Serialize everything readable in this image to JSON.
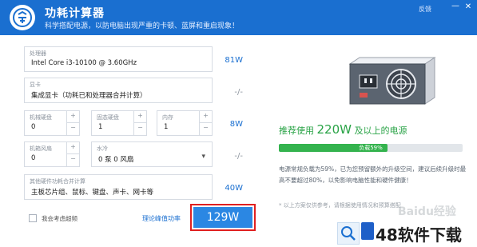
{
  "header": {
    "title": "功耗计算器",
    "subtitle": "科学搭配电源，以防电脑出现严重的卡顿、蓝屏和重启现象！",
    "feedback": "反馈",
    "minimize": "—",
    "close": "✕"
  },
  "form": {
    "cpu": {
      "label": "处理器",
      "value": "Intel Core i3-10100 @ 3.60GHz",
      "watt": "81W"
    },
    "gpu": {
      "label": "显卡",
      "value": "集成显卡（功耗已和处理器合并计算）",
      "watt": "-/-"
    },
    "hdd": {
      "label": "机械硬盘",
      "value": "0"
    },
    "ssd": {
      "label": "固态硬盘",
      "value": "1"
    },
    "ram": {
      "label": "内存",
      "value": "1",
      "watt": "8W"
    },
    "fan": {
      "label": "机箱风扇",
      "value": "0"
    },
    "water": {
      "label": "水冷",
      "value": "0 泵 0 风扇",
      "watt": "-/-"
    },
    "other": {
      "label": "其他硬件功耗合并计算",
      "value": "主板芯片组、鼠标、键盘、声卡、网卡等",
      "watt": "40W"
    },
    "spin_plus": "+",
    "spin_minus": "−",
    "dropdown_arrow": "▾"
  },
  "footer": {
    "overclock_label": "我会考虑超频",
    "overclock_checked": false,
    "theory_link": "理论峰值功率",
    "total": "129W"
  },
  "result": {
    "recommend_prefix": "推荐使用",
    "recommend_watt": "220W",
    "recommend_suffix": "及以上的电源",
    "load_label": "负载59%",
    "load_percent": 59,
    "advice": "电源常规负载为59%，已为您预留额外的升级空间，建议后续升级时最高不要超过80%，以免影响电脑性能和硬件健康！",
    "note": "* 以上方案仅供参考，请根据使用情况和预算搭配"
  },
  "watermark": {
    "baidu": "Baidu经验",
    "site": "48软件下载"
  },
  "colors": {
    "brand": "#1a6fd0",
    "accent_button": "#2b87e3",
    "highlight_border": "#e02020",
    "success": "#29a346"
  },
  "icons": [
    "app-logo-icon",
    "psu-icon",
    "search-icon",
    "checkbox-icon",
    "dropdown-arrow-icon"
  ]
}
